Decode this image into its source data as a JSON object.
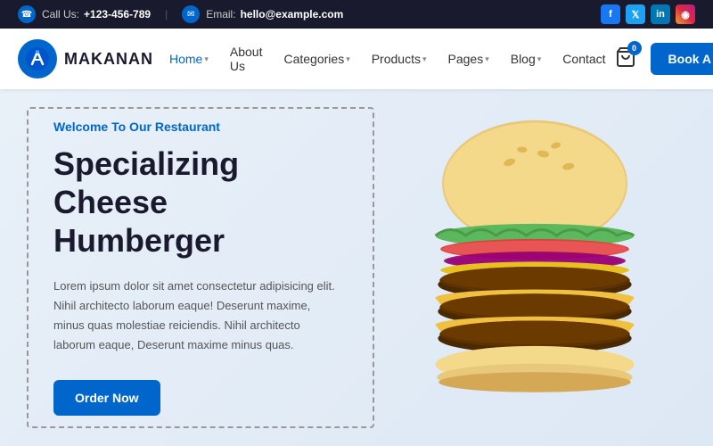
{
  "topbar": {
    "phone_label": "Call Us:",
    "phone_number": "+123-456-789",
    "email_label": "Email:",
    "email_address": "hello@example.com",
    "social": [
      {
        "name": "facebook",
        "letter": "f"
      },
      {
        "name": "twitter",
        "letter": "t"
      },
      {
        "name": "linkedin",
        "letter": "in"
      },
      {
        "name": "instagram",
        "letter": "ig"
      }
    ]
  },
  "header": {
    "logo_text": "MAKANAN",
    "nav": [
      {
        "label": "Home",
        "has_dropdown": true,
        "active": true
      },
      {
        "label": "About Us",
        "has_dropdown": false
      },
      {
        "label": "Categories",
        "has_dropdown": true
      },
      {
        "label": "Products",
        "has_dropdown": true
      },
      {
        "label": "Pages",
        "has_dropdown": true
      },
      {
        "label": "Blog",
        "has_dropdown": true
      },
      {
        "label": "Contact",
        "has_dropdown": false
      }
    ],
    "cart_count": "0",
    "cta_label": "Book A Table"
  },
  "hero": {
    "welcome_text": "Welcome To Our Restaurant",
    "title_line1": "Specializing Cheese",
    "title_line2": "Humberger",
    "description": "Lorem ipsum dolor sit amet consectetur adipisicing elit. Nihil architecto laborum eaque! Deserunt maxime, minus quas molestiae reiciendis. Nihil architecto laborum eaque, Deserunt maxime minus quas.",
    "cta_label": "Order Now"
  }
}
